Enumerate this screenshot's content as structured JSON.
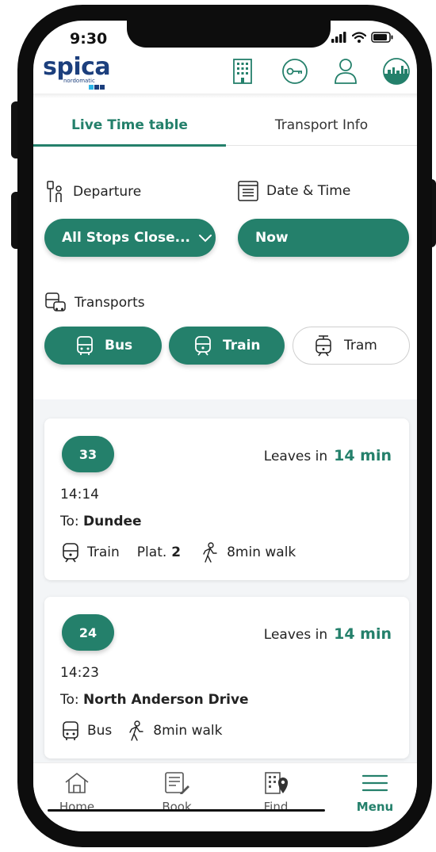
{
  "status": {
    "time": "9:30"
  },
  "header": {
    "logo_text": "spica",
    "logo_subtext": "nordomatic"
  },
  "tabs": [
    {
      "label": "Live Time table",
      "active": true
    },
    {
      "label": "Transport Info",
      "active": false
    }
  ],
  "filters": {
    "departure": {
      "label": "Departure",
      "value": "All Stops Close..."
    },
    "datetime": {
      "label": "Date & Time",
      "value": "Now"
    },
    "transports": {
      "label": "Transports",
      "options": [
        {
          "label": "Bus",
          "selected": true
        },
        {
          "label": "Train",
          "selected": true
        },
        {
          "label": "Tram",
          "selected": false
        }
      ]
    }
  },
  "departures": [
    {
      "route": "33",
      "leaves_prefix": "Leaves in",
      "leaves_value": "14 min",
      "time": "14:14",
      "to_prefix": "To:",
      "destination": "Dundee",
      "mode": "Train",
      "platform_prefix": "Plat.",
      "platform": "2",
      "walk": "8min walk"
    },
    {
      "route": "24",
      "leaves_prefix": "Leaves in",
      "leaves_value": "14 min",
      "time": "14:23",
      "to_prefix": "To:",
      "destination": "North Anderson Drive",
      "mode": "Bus",
      "walk": "8min walk"
    }
  ],
  "nav": [
    {
      "label": "Home",
      "active": false
    },
    {
      "label": "Book",
      "active": false
    },
    {
      "label": "Find",
      "active": false
    },
    {
      "label": "Menu",
      "active": true
    }
  ],
  "colors": {
    "accent": "#24806b",
    "brand": "#1c3f7d"
  }
}
